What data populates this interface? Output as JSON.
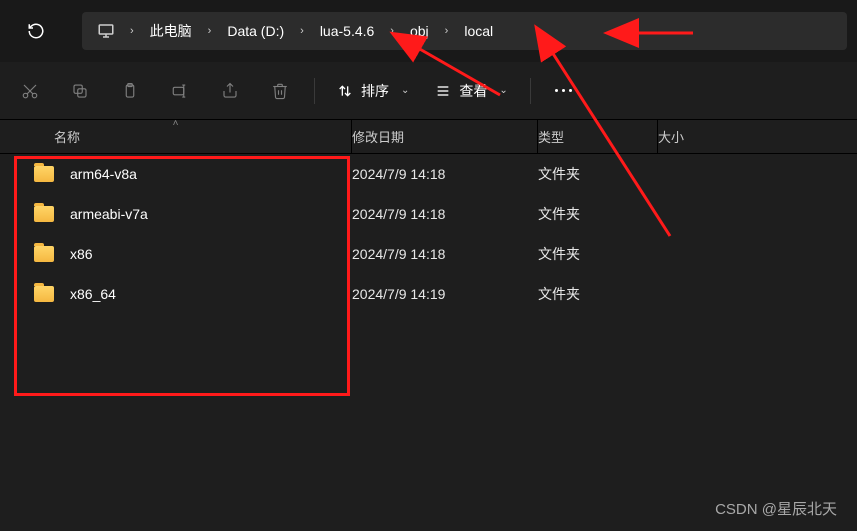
{
  "breadcrumb": {
    "items": [
      {
        "label": "此电脑"
      },
      {
        "label": "Data (D:)"
      },
      {
        "label": "lua-5.4.6"
      },
      {
        "label": "obj"
      },
      {
        "label": "local"
      }
    ]
  },
  "toolbar": {
    "sort_label": "排序",
    "view_label": "查看"
  },
  "columns": {
    "name": "名称",
    "date": "修改日期",
    "type": "类型",
    "size": "大小"
  },
  "rows": [
    {
      "name": "arm64-v8a",
      "date": "2024/7/9 14:18",
      "type": "文件夹",
      "size": ""
    },
    {
      "name": "armeabi-v7a",
      "date": "2024/7/9 14:18",
      "type": "文件夹",
      "size": ""
    },
    {
      "name": "x86",
      "date": "2024/7/9 14:18",
      "type": "文件夹",
      "size": ""
    },
    {
      "name": "x86_64",
      "date": "2024/7/9 14:19",
      "type": "文件夹",
      "size": ""
    }
  ],
  "watermark": "CSDN @星辰北天"
}
